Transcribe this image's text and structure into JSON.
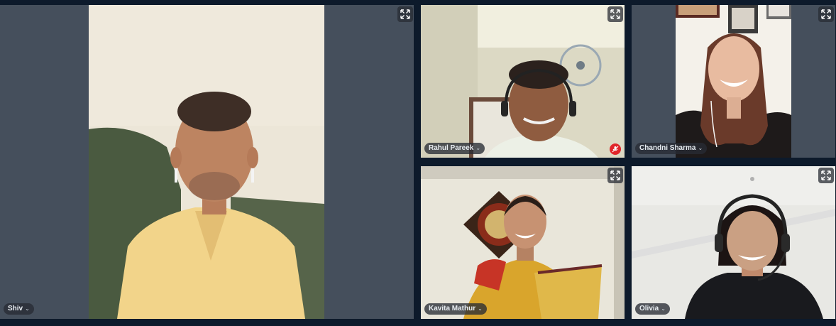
{
  "participants": [
    {
      "name": "Shiv",
      "muted": false
    },
    {
      "name": "Rahul Pareek",
      "muted": true
    },
    {
      "name": "Chandni Sharma",
      "muted": false
    },
    {
      "name": "Kavita Mathur",
      "muted": false
    },
    {
      "name": "Olivia",
      "muted": false
    }
  ],
  "icons": {
    "expand": "expand-arrows-icon",
    "muted": "mic-muted-icon",
    "menu": "chevron-down-icon"
  },
  "colors": {
    "background": "#0d1a2b",
    "tile": "#454f5c",
    "mute": "#e0252a"
  }
}
